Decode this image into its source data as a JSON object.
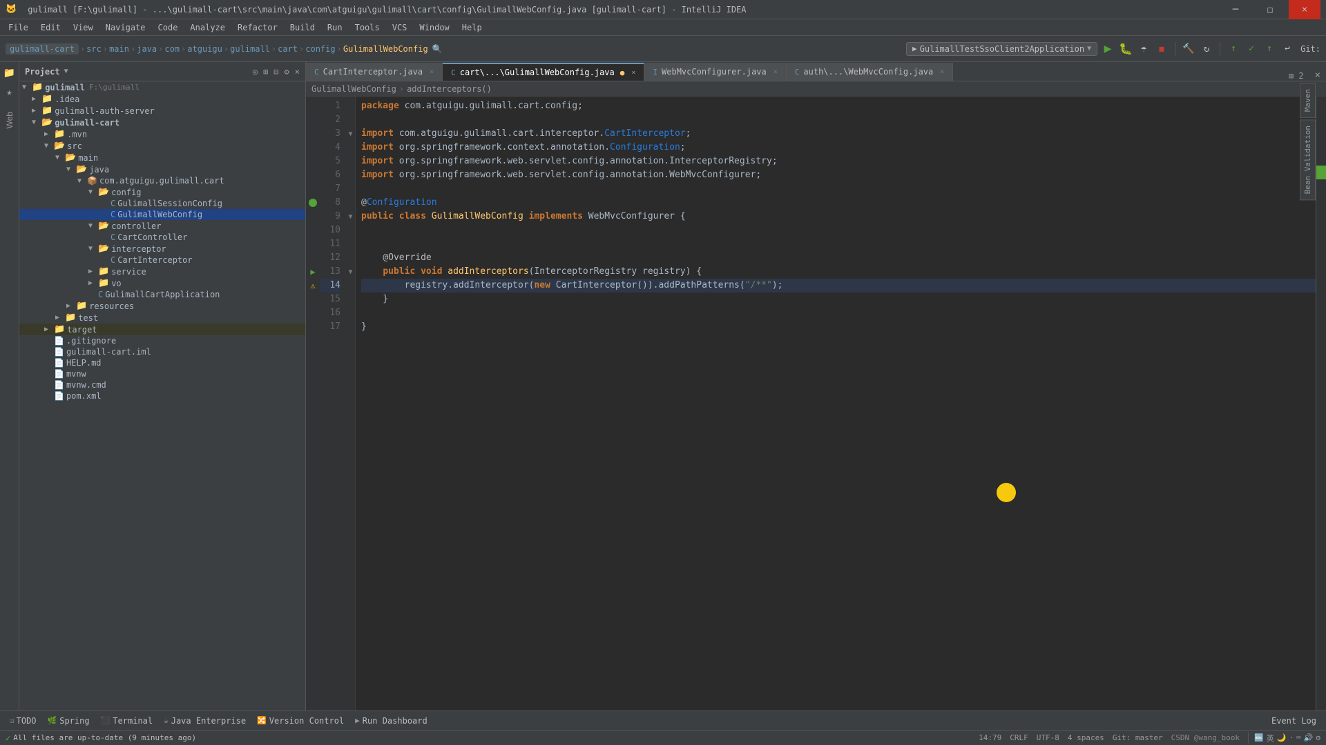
{
  "window": {
    "title": "gulimall [F:\\gulimall] - ...\\gulimall-cart\\src\\main\\java\\com\\atguigu\\gulimall\\cart\\config\\GulimallWebConfig.java [gulimall-cart] - IntelliJ IDEA"
  },
  "menu": {
    "items": [
      "File",
      "Edit",
      "View",
      "Navigate",
      "Code",
      "Analyze",
      "Refactor",
      "Build",
      "Run",
      "Tools",
      "VCS",
      "Window",
      "Help"
    ]
  },
  "toolbar": {
    "breadcrumb": [
      "gulimall-cart",
      "src",
      "main",
      "java",
      "com",
      "atguigu",
      "gulimall",
      "cart",
      "config",
      "GulimallWebConfig"
    ],
    "run_config": "GulimallTestSsoClient2Application",
    "git_label": "Git:"
  },
  "tabs": [
    {
      "label": "CartInterceptor.java",
      "active": false
    },
    {
      "label": "cart\\...\\GulimallWebConfig.java",
      "active": false,
      "modified": true
    },
    {
      "label": "WebMvcConfigurer.java",
      "active": false
    },
    {
      "label": "auth\\...\\WebMvcConfig.java",
      "active": false
    }
  ],
  "editor_breadcrumb": {
    "class": "GulimallWebConfig",
    "method": "addInterceptors()"
  },
  "project": {
    "title": "Project",
    "root": "gulimall",
    "root_path": "F:\\gulimall",
    "tree": [
      {
        "id": "gulimall",
        "label": "gulimall",
        "path": "F:\\gulimall",
        "type": "root",
        "depth": 0,
        "expanded": true
      },
      {
        "id": "idea",
        "label": ".idea",
        "type": "folder",
        "depth": 1,
        "expanded": false
      },
      {
        "id": "auth-server",
        "label": "gulimall-auth-server",
        "type": "module",
        "depth": 1,
        "expanded": false
      },
      {
        "id": "cart",
        "label": "gulimall-cart",
        "type": "module",
        "depth": 1,
        "expanded": true
      },
      {
        "id": "mvn",
        "label": ".mvn",
        "type": "folder",
        "depth": 2,
        "expanded": false
      },
      {
        "id": "src",
        "label": "src",
        "type": "folder",
        "depth": 2,
        "expanded": true
      },
      {
        "id": "main",
        "label": "main",
        "type": "folder",
        "depth": 3,
        "expanded": true
      },
      {
        "id": "java",
        "label": "java",
        "type": "folder",
        "depth": 4,
        "expanded": true
      },
      {
        "id": "com.atguigu.gulimall.cart",
        "label": "com.atguigu.gulimall.cart",
        "type": "package",
        "depth": 5,
        "expanded": true
      },
      {
        "id": "config",
        "label": "config",
        "type": "folder",
        "depth": 6,
        "expanded": true
      },
      {
        "id": "GulimallSessionConfig",
        "label": "GulimallSessionConfig",
        "type": "java",
        "depth": 7
      },
      {
        "id": "GulimallWebConfig",
        "label": "GulimallWebConfig",
        "type": "java",
        "depth": 7,
        "selected": true
      },
      {
        "id": "controller",
        "label": "controller",
        "type": "folder",
        "depth": 6,
        "expanded": true
      },
      {
        "id": "CartController",
        "label": "CartController",
        "type": "java",
        "depth": 7
      },
      {
        "id": "interceptor",
        "label": "interceptor",
        "type": "folder",
        "depth": 6,
        "expanded": true
      },
      {
        "id": "CartInterceptor",
        "label": "CartInterceptor",
        "type": "java",
        "depth": 7
      },
      {
        "id": "service",
        "label": "service",
        "type": "folder",
        "depth": 6,
        "expanded": false
      },
      {
        "id": "vo",
        "label": "vo",
        "type": "folder",
        "depth": 6,
        "expanded": false
      },
      {
        "id": "GulimallCartApplication",
        "label": "GulimallCartApplication",
        "type": "java",
        "depth": 6
      },
      {
        "id": "resources",
        "label": "resources",
        "type": "folder",
        "depth": 3,
        "expanded": false
      },
      {
        "id": "test",
        "label": "test",
        "type": "folder",
        "depth": 2,
        "expanded": false
      },
      {
        "id": "target",
        "label": "target",
        "type": "folder",
        "depth": 2,
        "expanded": false,
        "highlight": true
      },
      {
        "id": "gitignore",
        "label": ".gitignore",
        "type": "file",
        "depth": 2
      },
      {
        "id": "gulimall-cart.iml",
        "label": "gulimall-cart.iml",
        "type": "iml",
        "depth": 2
      },
      {
        "id": "HELP.md",
        "label": "HELP.md",
        "type": "md",
        "depth": 2
      },
      {
        "id": "mvnw",
        "label": "mvnw",
        "type": "file",
        "depth": 2
      },
      {
        "id": "mvnw.cmd",
        "label": "mvnw.cmd",
        "type": "file",
        "depth": 2
      },
      {
        "id": "pom.xml",
        "label": "pom.xml",
        "type": "xml",
        "depth": 2
      }
    ]
  },
  "code": {
    "filename": "GulimallWebConfig.java",
    "lines": [
      {
        "n": 1,
        "text": "package com.atguigu.gulimall.cart.config;"
      },
      {
        "n": 2,
        "text": ""
      },
      {
        "n": 3,
        "text": "import com.atguigu.gulimall.cart.interceptor.CartInterceptor;"
      },
      {
        "n": 4,
        "text": "import org.springframework.context.annotation.Configuration;"
      },
      {
        "n": 5,
        "text": "import org.springframework.web.servlet.config.annotation.InterceptorRegistry;"
      },
      {
        "n": 6,
        "text": "import org.springframework.web.servlet.config.annotation.WebMvcConfigurer;"
      },
      {
        "n": 7,
        "text": ""
      },
      {
        "n": 8,
        "text": "@Configuration"
      },
      {
        "n": 9,
        "text": "public class GulimallWebConfig implements WebMvcConfigurer {"
      },
      {
        "n": 10,
        "text": ""
      },
      {
        "n": 11,
        "text": ""
      },
      {
        "n": 12,
        "text": "    @Override"
      },
      {
        "n": 13,
        "text": "    public void addInterceptors(InterceptorRegistry registry) {"
      },
      {
        "n": 14,
        "text": "        registry.addInterceptor(new CartInterceptor()).addPathPatterns(\"/**\");"
      },
      {
        "n": 15,
        "text": "    }"
      },
      {
        "n": 16,
        "text": ""
      },
      {
        "n": 17,
        "text": "}"
      }
    ]
  },
  "status_bar": {
    "todo": "TODO",
    "spring": "Spring",
    "terminal": "Terminal",
    "java_enterprise": "Java Enterprise",
    "version_control": "Version Control",
    "run_dashboard": "Run Dashboard",
    "event_log": "Event Log",
    "position": "14:79",
    "crlf": "CRLF",
    "encoding": "UTF-8",
    "indent": "4 spaces",
    "git": "Git: master",
    "status_msg": "All files are up-to-date (9 minutes ago)",
    "user": "CSDN @wang_book"
  },
  "side_tabs": [
    "Maven",
    "Bean Validation"
  ],
  "icons": {
    "run": "▶",
    "stop": "◼",
    "debug": "🐛",
    "build": "🔨",
    "folder_open": "📂",
    "folder": "📁",
    "java": "☕",
    "package": "📦",
    "expand": "▶",
    "collapse": "▼",
    "close": "×",
    "search": "🔍",
    "settings": "⚙",
    "run_green": "▶"
  }
}
